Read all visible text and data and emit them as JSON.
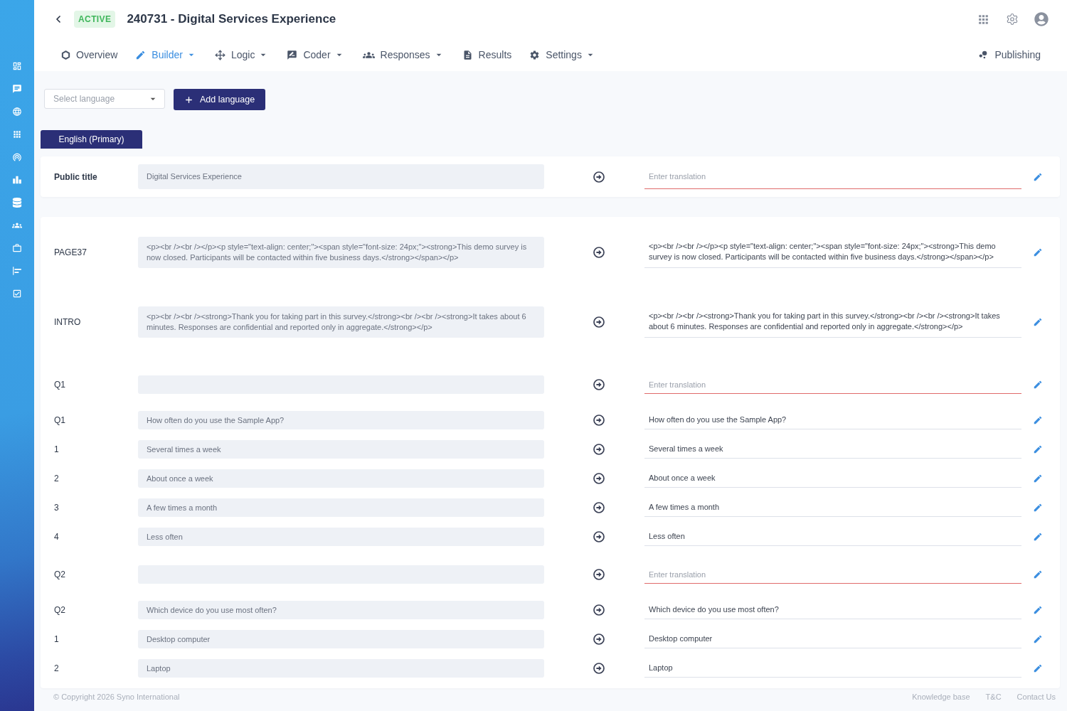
{
  "header": {
    "status_badge": "ACTIVE",
    "title": "240731 - Digital Services Experience"
  },
  "nav": {
    "items": [
      {
        "label": "Overview",
        "selected": false,
        "has_menu": false
      },
      {
        "label": "Builder",
        "selected": true,
        "has_menu": true
      },
      {
        "label": "Logic",
        "selected": false,
        "has_menu": true
      },
      {
        "label": "Coder",
        "selected": false,
        "has_menu": true
      },
      {
        "label": "Responses",
        "selected": false,
        "has_menu": true
      },
      {
        "label": "Results",
        "selected": false,
        "has_menu": false
      },
      {
        "label": "Settings",
        "selected": false,
        "has_menu": true
      }
    ],
    "publishing": "Publishing"
  },
  "language_bar": {
    "select": {
      "placeholder": "Select language"
    },
    "add_button": "Add language"
  },
  "language_tabs": [
    {
      "label": "English (Primary)",
      "selected": true
    }
  ],
  "title_section": {
    "label": "Public title",
    "source": "Digital Services Experience",
    "translation": {
      "placeholder": "Enter translation",
      "error": true
    }
  },
  "rows": [
    {
      "kind": "html",
      "label": "PAGE37",
      "source": "<p><br /><br /></p><p style=\"text-align: center;\"><span style=\"font-size: 24px;\"><strong>This demo survey is now closed. Participants will be contacted within five business days.</strong></span></p>",
      "translation": {
        "value": "<p><br /><br /></p><p style=\"text-align: center;\"><span style=\"font-size: 24px;\"><strong>This demo survey is now closed. Participants will be contacted within five business days.</strong></span></p>",
        "error": false
      }
    },
    {
      "kind": "html",
      "label": "INTRO",
      "source": "<p><br /><br /><strong>Thank you for taking part in this survey.</strong><br /><br /><strong>It takes about 6 minutes. Responses are confidential and reported only in aggregate.</strong></p>",
      "translation": {
        "value": "<p><br /><br /><strong>Thank you for taking part in this survey.</strong><br /><br /><strong>It takes about 6 minutes. Responses are confidential and reported only in aggregate.</strong></p>",
        "error": false
      }
    },
    {
      "kind": "title",
      "label": "Q1",
      "translation": {
        "placeholder": "Enter translation",
        "error": true
      }
    },
    {
      "kind": "question",
      "label": "Q1",
      "source": "How often do you use the Sample App?",
      "translation": {
        "value": "How often do you use the Sample App?",
        "error": false
      }
    },
    {
      "kind": "option",
      "label": "1",
      "source": "Several times a week",
      "translation": {
        "value": "Several times a week",
        "error": false
      }
    },
    {
      "kind": "option",
      "label": "2",
      "source": "About once a week",
      "translation": {
        "value": "About once a week",
        "error": false
      }
    },
    {
      "kind": "option",
      "label": "3",
      "source": "A few times a month",
      "translation": {
        "value": "A few times a month",
        "error": false
      }
    },
    {
      "kind": "option",
      "label": "4",
      "source": "Less often",
      "translation": {
        "value": "Less often",
        "error": false
      }
    },
    {
      "kind": "title",
      "label": "Q2",
      "translation": {
        "placeholder": "Enter translation",
        "error": true
      }
    },
    {
      "kind": "question",
      "label": "Q2",
      "source": "Which device do you use most often?",
      "translation": {
        "value": "Which device do you use most often?",
        "error": false
      }
    },
    {
      "kind": "option",
      "label": "1",
      "source": "Desktop computer",
      "translation": {
        "value": "Desktop computer",
        "error": false
      }
    },
    {
      "kind": "option",
      "label": "2",
      "source": "Laptop",
      "translation": {
        "value": "Laptop",
        "error": false
      }
    }
  ],
  "footer": {
    "copyright": "© Copyright 2026 Syno International",
    "links": [
      "Knowledge base",
      "T&C",
      "Contact Us"
    ]
  }
}
